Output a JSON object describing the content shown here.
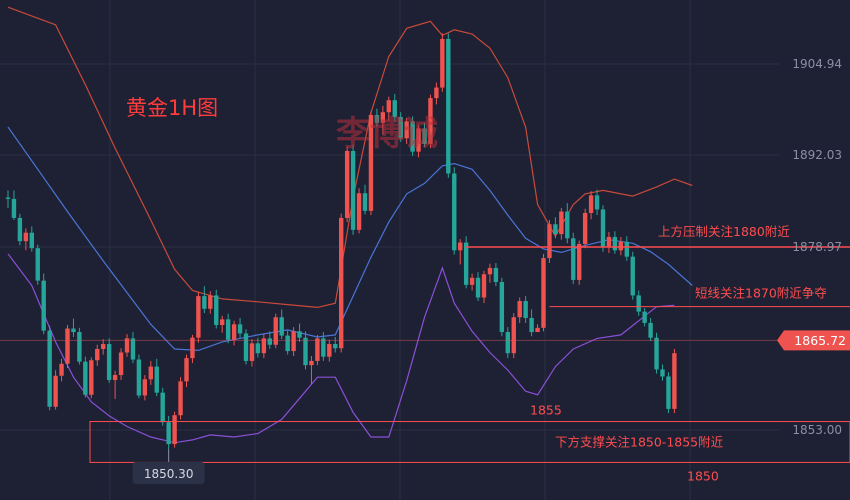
{
  "chart_data": {
    "type": "candlestick",
    "title": "黄金1H图",
    "watermark": "李博诚",
    "y_axis": {
      "side": "right",
      "ticks": [
        1904.94,
        1892.03,
        1878.97,
        1865.72,
        1853.0
      ],
      "ylim": [
        1847.6,
        1912.1
      ]
    },
    "current_price": {
      "label": "1865.72",
      "value": 1865.72
    },
    "low_label": {
      "label": "1850.30",
      "value": 1850.3
    },
    "series": [
      {
        "name": "candles",
        "ohlc": [
          [
            1886.0,
            1887.0,
            1884.5,
            1885.8
          ],
          [
            1885.8,
            1887.0,
            1882.8,
            1883.1
          ],
          [
            1883.1,
            1883.7,
            1879.2,
            1879.8
          ],
          [
            1879.8,
            1881.6,
            1878.5,
            1881.0
          ],
          [
            1881.0,
            1881.9,
            1878.3,
            1878.8
          ],
          [
            1878.8,
            1879.3,
            1873.6,
            1874.2
          ],
          [
            1874.2,
            1875.2,
            1866.6,
            1867.1
          ],
          [
            1867.1,
            1867.8,
            1855.8,
            1856.3
          ],
          [
            1856.3,
            1861.5,
            1855.9,
            1860.7
          ],
          [
            1860.7,
            1863.1,
            1859.9,
            1862.4
          ],
          [
            1862.4,
            1867.9,
            1861.8,
            1867.4
          ],
          [
            1867.4,
            1868.8,
            1866.2,
            1866.9
          ],
          [
            1866.9,
            1867.5,
            1862.3,
            1862.7
          ],
          [
            1862.7,
            1863.4,
            1857.6,
            1858.0
          ],
          [
            1858.0,
            1863.3,
            1857.5,
            1862.9
          ],
          [
            1862.9,
            1865.1,
            1862.1,
            1864.5
          ],
          [
            1864.5,
            1865.9,
            1863.7,
            1865.2
          ],
          [
            1865.2,
            1866.0,
            1859.7,
            1860.1
          ],
          [
            1860.1,
            1861.4,
            1857.4,
            1860.8
          ],
          [
            1860.8,
            1864.6,
            1860.1,
            1864.0
          ],
          [
            1864.0,
            1866.6,
            1863.4,
            1866.0
          ],
          [
            1866.0,
            1866.9,
            1862.5,
            1863.0
          ],
          [
            1863.0,
            1863.7,
            1857.5,
            1857.9
          ],
          [
            1857.9,
            1860.8,
            1857.2,
            1860.2
          ],
          [
            1860.2,
            1862.8,
            1859.4,
            1862.0
          ],
          [
            1862.0,
            1863.1,
            1857.8,
            1858.3
          ],
          [
            1858.3,
            1859.0,
            1853.6,
            1854.1
          ],
          [
            1854.1,
            1855.0,
            1850.3,
            1851.0
          ],
          [
            1851.0,
            1855.6,
            1850.5,
            1855.1
          ],
          [
            1855.1,
            1860.5,
            1854.5,
            1859.9
          ],
          [
            1859.9,
            1863.7,
            1859.1,
            1863.2
          ],
          [
            1863.2,
            1866.5,
            1862.5,
            1866.1
          ],
          [
            1866.1,
            1872.6,
            1865.4,
            1872.0
          ],
          [
            1872.0,
            1873.4,
            1869.6,
            1870.2
          ],
          [
            1870.2,
            1872.7,
            1869.5,
            1872.1
          ],
          [
            1872.1,
            1872.9,
            1867.4,
            1867.9
          ],
          [
            1867.9,
            1869.2,
            1866.8,
            1868.7
          ],
          [
            1868.7,
            1869.5,
            1865.3,
            1865.8
          ],
          [
            1865.8,
            1868.5,
            1865.0,
            1868.0
          ],
          [
            1868.0,
            1868.9,
            1866.1,
            1866.7
          ],
          [
            1866.7,
            1867.3,
            1862.3,
            1862.8
          ],
          [
            1862.8,
            1865.9,
            1862.0,
            1865.3
          ],
          [
            1865.3,
            1866.1,
            1863.3,
            1863.9
          ],
          [
            1863.9,
            1866.6,
            1863.2,
            1866.0
          ],
          [
            1866.0,
            1867.0,
            1864.5,
            1865.1
          ],
          [
            1865.1,
            1869.5,
            1864.6,
            1869.0
          ],
          [
            1869.0,
            1870.1,
            1865.9,
            1866.4
          ],
          [
            1866.4,
            1867.1,
            1863.7,
            1864.2
          ],
          [
            1864.2,
            1867.6,
            1863.5,
            1867.0
          ],
          [
            1867.0,
            1868.1,
            1865.5,
            1866.1
          ],
          [
            1866.1,
            1867.0,
            1861.6,
            1862.2
          ],
          [
            1862.2,
            1863.5,
            1859.6,
            1862.8
          ],
          [
            1862.8,
            1866.5,
            1862.2,
            1866.0
          ],
          [
            1866.0,
            1866.9,
            1862.8,
            1863.4
          ],
          [
            1863.4,
            1865.8,
            1862.7,
            1865.2
          ],
          [
            1865.2,
            1866.2,
            1864.0,
            1864.6
          ],
          [
            1864.6,
            1883.7,
            1864.0,
            1883.1
          ],
          [
            1883.1,
            1893.2,
            1882.5,
            1892.6
          ],
          [
            1892.6,
            1893.5,
            1880.7,
            1881.4
          ],
          [
            1881.4,
            1887.3,
            1880.9,
            1886.6
          ],
          [
            1886.6,
            1887.8,
            1883.6,
            1884.1
          ],
          [
            1884.1,
            1898.2,
            1883.5,
            1897.7
          ],
          [
            1897.7,
            1898.6,
            1896.0,
            1896.6
          ],
          [
            1896.6,
            1899.0,
            1894.9,
            1898.1
          ],
          [
            1898.1,
            1900.3,
            1896.9,
            1899.8
          ],
          [
            1899.8,
            1900.7,
            1896.8,
            1897.4
          ],
          [
            1897.4,
            1898.1,
            1893.9,
            1894.4
          ],
          [
            1894.4,
            1897.3,
            1893.6,
            1896.8
          ],
          [
            1896.8,
            1897.5,
            1891.9,
            1892.5
          ],
          [
            1892.5,
            1896.3,
            1891.7,
            1895.8
          ],
          [
            1895.8,
            1896.6,
            1893.1,
            1893.6
          ],
          [
            1893.6,
            1900.6,
            1893.0,
            1900.1
          ],
          [
            1900.1,
            1902.3,
            1899.2,
            1901.6
          ],
          [
            1901.6,
            1909.3,
            1901.0,
            1908.5
          ],
          [
            1908.5,
            1909.3,
            1888.8,
            1889.4
          ],
          [
            1889.4,
            1890.3,
            1877.9,
            1878.5
          ],
          [
            1878.5,
            1880.1,
            1876.5,
            1879.6
          ],
          [
            1879.6,
            1880.5,
            1873.1,
            1873.6
          ],
          [
            1873.6,
            1875.2,
            1872.8,
            1874.6
          ],
          [
            1874.6,
            1875.4,
            1871.3,
            1871.8
          ],
          [
            1871.8,
            1875.6,
            1871.0,
            1875.1
          ],
          [
            1875.1,
            1876.6,
            1873.9,
            1876.0
          ],
          [
            1876.0,
            1876.7,
            1873.4,
            1874.0
          ],
          [
            1874.0,
            1874.6,
            1866.3,
            1866.9
          ],
          [
            1866.9,
            1867.6,
            1863.2,
            1863.9
          ],
          [
            1863.9,
            1869.6,
            1863.2,
            1869.0
          ],
          [
            1869.0,
            1871.8,
            1868.2,
            1871.3
          ],
          [
            1871.3,
            1872.0,
            1868.2,
            1868.9
          ],
          [
            1868.9,
            1870.1,
            1866.3,
            1866.9
          ],
          [
            1866.9,
            1868.0,
            1867.2,
            1867.5
          ],
          [
            1867.5,
            1878.0,
            1867.0,
            1877.4
          ],
          [
            1877.4,
            1882.8,
            1876.7,
            1882.2
          ],
          [
            1882.2,
            1883.2,
            1880.2,
            1880.8
          ],
          [
            1880.8,
            1884.5,
            1880.0,
            1884.0
          ],
          [
            1884.0,
            1885.2,
            1879.5,
            1880.2
          ],
          [
            1880.2,
            1881.0,
            1873.7,
            1874.3
          ],
          [
            1874.3,
            1879.9,
            1873.6,
            1879.4
          ],
          [
            1879.4,
            1884.4,
            1878.8,
            1883.8
          ],
          [
            1883.8,
            1886.9,
            1882.9,
            1886.3
          ],
          [
            1886.3,
            1887.1,
            1883.5,
            1884.3
          ],
          [
            1884.3,
            1884.9,
            1878.3,
            1878.9
          ],
          [
            1878.9,
            1881.1,
            1878.1,
            1880.4
          ],
          [
            1880.4,
            1881.2,
            1878.0,
            1878.5
          ],
          [
            1878.5,
            1880.4,
            1877.8,
            1879.7
          ],
          [
            1879.7,
            1880.5,
            1877.0,
            1877.6
          ],
          [
            1877.6,
            1878.3,
            1871.5,
            1872.1
          ],
          [
            1872.1,
            1872.8,
            1869.2,
            1869.8
          ],
          [
            1869.8,
            1870.3,
            1867.7,
            1868.2
          ],
          [
            1868.2,
            1868.9,
            1865.6,
            1866.1
          ],
          [
            1866.1,
            1866.8,
            1861.0,
            1861.6
          ],
          [
            1861.6,
            1862.3,
            1860.0,
            1860.6
          ],
          [
            1860.6,
            1861.2,
            1855.4,
            1856.0
          ],
          [
            1856.0,
            1864.5,
            1855.4,
            1863.9
          ]
        ]
      },
      {
        "name": "boll-upper",
        "values": [
          [
            0,
            1913.0
          ],
          [
            8,
            1910.5
          ],
          [
            13,
            1902.0
          ],
          [
            18,
            1893.0
          ],
          [
            24,
            1882.8
          ],
          [
            28,
            1875.8
          ],
          [
            31,
            1872.8
          ],
          [
            36,
            1871.6
          ],
          [
            42,
            1871.2
          ],
          [
            47,
            1870.8
          ],
          [
            52,
            1870.4
          ],
          [
            55,
            1871.0
          ],
          [
            58,
            1886.0
          ],
          [
            61,
            1898.0
          ],
          [
            64,
            1906.0
          ],
          [
            67,
            1910.0
          ],
          [
            71,
            1911.0
          ],
          [
            73,
            1909.0
          ],
          [
            75,
            1909.8
          ],
          [
            78,
            1909.2
          ],
          [
            81,
            1907.2
          ],
          [
            84,
            1903.0
          ],
          [
            87,
            1896.0
          ],
          [
            89,
            1885.0
          ],
          [
            92,
            1880.5
          ],
          [
            95,
            1885.0
          ],
          [
            97,
            1886.5
          ],
          [
            100,
            1887.0
          ],
          [
            105,
            1886.2
          ],
          [
            109,
            1887.5
          ],
          [
            112,
            1888.6
          ],
          [
            115,
            1887.7
          ]
        ]
      },
      {
        "name": "boll-middle",
        "values": [
          [
            0,
            1896.0
          ],
          [
            5,
            1890.0
          ],
          [
            10,
            1884.0
          ],
          [
            16,
            1877.0
          ],
          [
            20,
            1872.5
          ],
          [
            24,
            1868.0
          ],
          [
            28,
            1864.5
          ],
          [
            32,
            1864.3
          ],
          [
            36,
            1865.5
          ],
          [
            42,
            1866.5
          ],
          [
            47,
            1867.2
          ],
          [
            52,
            1866.2
          ],
          [
            55,
            1866.5
          ],
          [
            58,
            1872.0
          ],
          [
            61,
            1877.5
          ],
          [
            64,
            1882.5
          ],
          [
            67,
            1886.5
          ],
          [
            70,
            1888.0
          ],
          [
            73,
            1890.5
          ],
          [
            75,
            1890.8
          ],
          [
            78,
            1890.0
          ],
          [
            81,
            1887.0
          ],
          [
            84,
            1883.5
          ],
          [
            87,
            1880.2
          ],
          [
            90,
            1878.7
          ],
          [
            93,
            1878.2
          ],
          [
            97,
            1879.2
          ],
          [
            101,
            1880.0
          ],
          [
            105,
            1879.5
          ],
          [
            108,
            1878.3
          ],
          [
            111,
            1876.5
          ],
          [
            115,
            1873.5
          ]
        ]
      },
      {
        "name": "boll-lower",
        "values": [
          [
            0,
            1878.0
          ],
          [
            4,
            1873.5
          ],
          [
            8,
            1865.5
          ],
          [
            11,
            1860.5
          ],
          [
            14,
            1857.0
          ],
          [
            17,
            1855.0
          ],
          [
            20,
            1853.5
          ],
          [
            24,
            1852.0
          ],
          [
            28,
            1851.2
          ],
          [
            31,
            1851.6
          ],
          [
            34,
            1852.3
          ],
          [
            38,
            1852.0
          ],
          [
            42,
            1852.5
          ],
          [
            46,
            1854.5
          ],
          [
            49,
            1857.5
          ],
          [
            52,
            1860.5
          ],
          [
            55,
            1860.5
          ],
          [
            58,
            1855.5
          ],
          [
            61,
            1852.0
          ],
          [
            64,
            1852.0
          ],
          [
            67,
            1860.0
          ],
          [
            70,
            1869.0
          ],
          [
            73,
            1876.0
          ],
          [
            75,
            1871.0
          ],
          [
            78,
            1867.0
          ],
          [
            81,
            1864.0
          ],
          [
            84,
            1861.5
          ],
          [
            87,
            1858.5
          ],
          [
            89,
            1858.0
          ],
          [
            92,
            1862.0
          ],
          [
            95,
            1864.5
          ],
          [
            99,
            1866.0
          ],
          [
            103,
            1866.5
          ],
          [
            106,
            1868.5
          ],
          [
            109,
            1870.5
          ],
          [
            112,
            1870.7
          ]
        ]
      }
    ],
    "annotations": [
      {
        "name": "resistance-1880",
        "text": "上方压制关注1880附近",
        "y": 1878.97,
        "line_from_candle": 77
      },
      {
        "name": "shortline-1870",
        "text": "短线关注1870附近争夺",
        "y": 1870.5,
        "line_from_candle": 91
      },
      {
        "name": "support-box",
        "text": "下方支撑关注1850-1855附近",
        "y_low": 1848.4,
        "y_high": 1854.2
      },
      {
        "name": "label-1855",
        "text": "1855",
        "value": 1855
      },
      {
        "name": "label-1850",
        "text": "1850",
        "value": 1850
      }
    ],
    "colors": {
      "background": "#1d2133",
      "grid": "#2a3045",
      "up": "#ef5350",
      "down": "#26a69a",
      "boll_upper": "#c94a3a",
      "boll_middle": "#4a74d6",
      "boll_lower": "#8b4fd8",
      "annotation": "#ff4d4f",
      "axis_text": "#8a90a6",
      "price_tag_bg": "#ef5350"
    },
    "grid": true
  }
}
